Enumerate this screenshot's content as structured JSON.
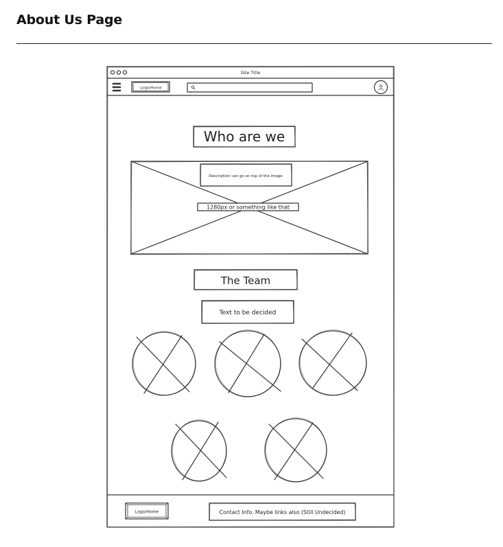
{
  "page": {
    "heading": "About Us Page"
  },
  "browser": {
    "title": "Site Title",
    "nav": {
      "logo_label": "Logo/Home"
    }
  },
  "content": {
    "hero_title": "Who are we",
    "image_description": "Description can go on top of the image",
    "image_size_note": "1280px or something like that",
    "team_title": "The Team",
    "team_text": "Text to be decided"
  },
  "footer": {
    "logo_label": "Logo/Home",
    "contact_text": "Contact Info. Maybe links also (Still Undecided)"
  }
}
